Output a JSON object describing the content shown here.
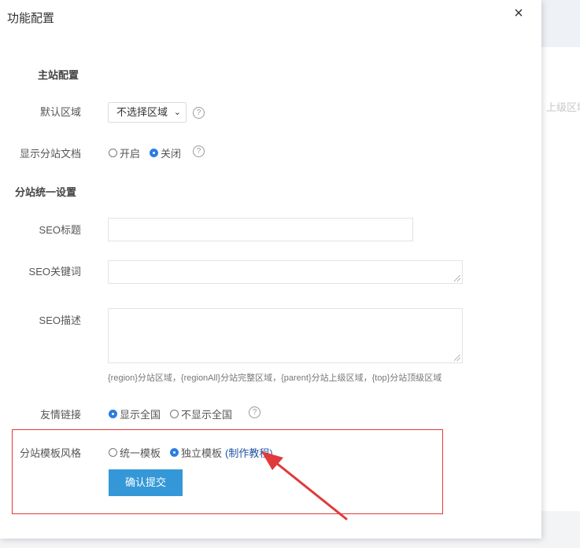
{
  "background": {
    "side_text": "上级区域"
  },
  "modal": {
    "title": "功能配置",
    "close_symbol": "×"
  },
  "main_site": {
    "section_title": "主站配置",
    "default_region_label": "默认区域",
    "default_region_value": "不选择区域",
    "show_doc_label": "显示分站文档",
    "show_doc_options": [
      "开启",
      "关闭"
    ],
    "show_doc_selected": "关闭"
  },
  "substation": {
    "section_title": "分站统一设置",
    "seo_title_label": "SEO标题",
    "seo_title_value": "",
    "seo_keywords_label": "SEO关键词",
    "seo_keywords_value": "",
    "seo_description_label": "SEO描述",
    "seo_description_value": "",
    "seo_hint": "{region}分站区域，{regionAll}分站完整区域，{parent}分站上级区域，{top}分站顶级区域",
    "friend_links_label": "友情链接",
    "friend_links_options": [
      "显示全国",
      "不显示全国"
    ],
    "friend_links_selected": "显示全国",
    "template_style_label": "分站模板风格",
    "template_style_options": [
      "统一模板",
      "独立模板"
    ],
    "template_style_selected": "独立模板",
    "tutorial_link": "(制作教程)"
  },
  "actions": {
    "submit_label": "确认提交"
  },
  "colors": {
    "accent": "#3498d8",
    "radio_checked": "#2a7de1",
    "highlight": "#e03a3a",
    "link": "#2255a4"
  },
  "icons": {
    "help": "question-circle-icon",
    "close": "close-icon",
    "select_chevron": "chevron-down-icon",
    "annotation_arrow": "arrow-icon"
  }
}
